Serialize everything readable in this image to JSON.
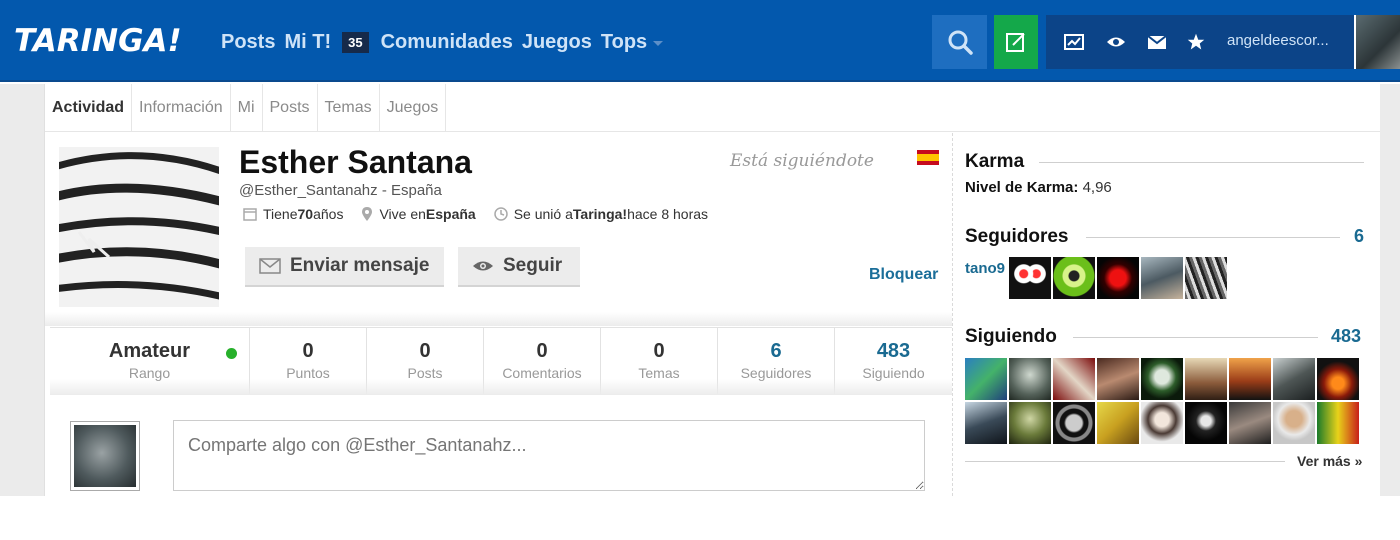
{
  "topbar": {
    "logo": "TARINGA!",
    "nav": {
      "posts": "Posts",
      "mit": "Mi T!",
      "mit_badge": "35",
      "comunidades": "Comunidades",
      "juegos": "Juegos",
      "tops": "Tops"
    },
    "username": "angeldeescor...",
    "icons": [
      "search-icon",
      "compose-icon",
      "stats-icon",
      "eye-icon",
      "mail-icon",
      "star-icon"
    ],
    "colors": {
      "bar": "#0358ad",
      "compose": "#14a84a",
      "search": "#1e6ec0"
    }
  },
  "tabs": [
    "Actividad",
    "Información",
    "Mi",
    "Posts",
    "Temas",
    "Juegos"
  ],
  "profile": {
    "name": "Esther Santana",
    "handle": "@Esther_Santanahz - España",
    "age_prefix": "Tiene ",
    "age": "70",
    "age_suffix": " años",
    "lives_prefix": "Vive en ",
    "lives": "España",
    "joined_prefix": "Se unió a ",
    "joined_site": "Taringa!",
    "joined_suffix": " hace 8 horas",
    "following_you": "Está siguiéndote",
    "send_message": "Enviar mensaje",
    "follow": "Seguir",
    "block": "Bloquear"
  },
  "stats": [
    {
      "value": "Amateur",
      "label": "Rango"
    },
    {
      "value": "0",
      "label": "Puntos"
    },
    {
      "value": "0",
      "label": "Posts"
    },
    {
      "value": "0",
      "label": "Comentarios"
    },
    {
      "value": "0",
      "label": "Temas"
    },
    {
      "value": "6",
      "label": "Seguidores"
    },
    {
      "value": "483",
      "label": "Siguiendo"
    }
  ],
  "composer": {
    "placeholder": "Comparte algo con @Esther_Santanahz..."
  },
  "sidebar": {
    "karma_title": "Karma",
    "karma_label": "Nivel de Karma:",
    "karma_value": "4,96",
    "followers_title": "Seguidores",
    "followers_count": "6",
    "followers_first": "tano9",
    "following_title": "Siguiendo",
    "following_count": "483",
    "see_more": "Ver más »"
  }
}
